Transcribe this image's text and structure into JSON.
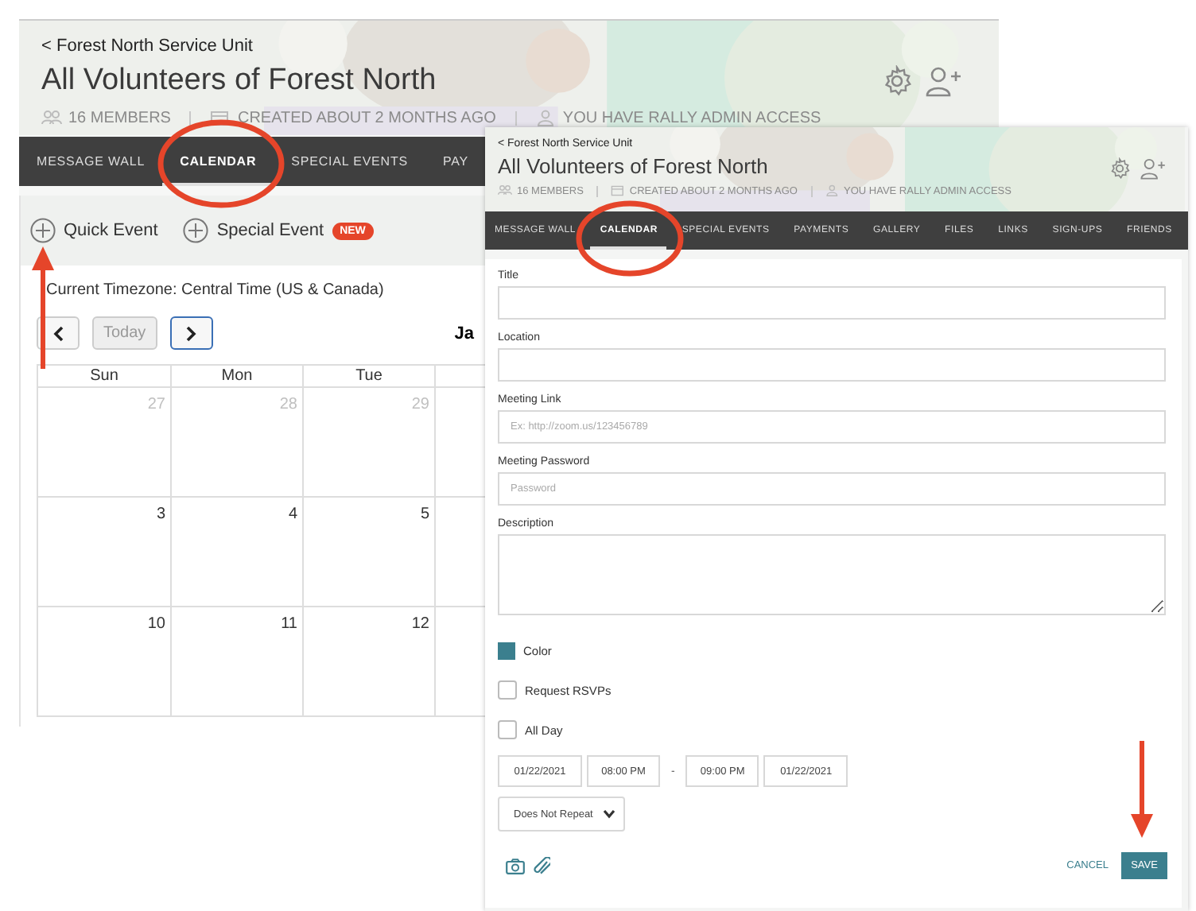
{
  "back_window": {
    "breadcrumb": "< Forest North Service Unit",
    "title": "All Volunteers of Forest North",
    "meta": [
      {
        "kind": "members",
        "text": "16 MEMBERS"
      },
      {
        "kind": "created",
        "text": "CREATED ABOUT 2 MONTHS AGO"
      },
      {
        "kind": "access",
        "text": "YOU HAVE RALLY ADMIN ACCESS"
      }
    ],
    "nav": [
      {
        "label": "MESSAGE WALL",
        "selected": false
      },
      {
        "label": "CALENDAR",
        "selected": true
      },
      {
        "label": "SPECIAL EVENTS",
        "selected": false
      },
      {
        "label": "PAY",
        "selected": false
      }
    ],
    "toolbar": [
      {
        "label": "Quick Event"
      },
      {
        "label": "Special Event",
        "badge": "NEW"
      }
    ],
    "timezone": "Current Timezone: Central Time (US & Canada)",
    "calendar": {
      "controls": [
        {
          "kind": "prev",
          "focused": false
        },
        {
          "kind": "today",
          "label": "Today",
          "disabled": true
        },
        {
          "kind": "next",
          "focused": true
        }
      ],
      "month_title": "Ja",
      "weekdays": [
        "Sun",
        "Mon",
        "Tue"
      ],
      "weeks": [
        [
          {
            "day": "27",
            "muted": true
          },
          {
            "day": "28",
            "muted": true
          },
          {
            "day": "29",
            "muted": true
          }
        ],
        [
          {
            "day": "3",
            "muted": false
          },
          {
            "day": "4",
            "muted": false
          },
          {
            "day": "5",
            "muted": false
          }
        ],
        [
          {
            "day": "10",
            "muted": false
          },
          {
            "day": "11",
            "muted": false
          },
          {
            "day": "12",
            "muted": false
          }
        ]
      ]
    }
  },
  "front_window": {
    "breadcrumb": "< Forest North Service Unit",
    "title": "All Volunteers of Forest North",
    "meta": [
      {
        "kind": "members",
        "text": "16 MEMBERS"
      },
      {
        "kind": "created",
        "text": "CREATED ABOUT 2 MONTHS AGO"
      },
      {
        "kind": "access",
        "text": "YOU HAVE RALLY ADMIN ACCESS"
      }
    ],
    "nav": [
      {
        "label": "MESSAGE WALL",
        "selected": false
      },
      {
        "label": "CALENDAR",
        "selected": true
      },
      {
        "label": "SPECIAL EVENTS",
        "selected": false
      },
      {
        "label": "PAYMENTS",
        "selected": false
      },
      {
        "label": "GALLERY",
        "selected": false
      },
      {
        "label": "FILES",
        "selected": false
      },
      {
        "label": "LINKS",
        "selected": false
      },
      {
        "label": "SIGN-UPS",
        "selected": false
      },
      {
        "label": "FRIENDS",
        "selected": false
      }
    ],
    "form": {
      "fields": [
        {
          "label": "Title",
          "kind": "text"
        },
        {
          "label": "Location",
          "kind": "text"
        },
        {
          "label": "Meeting Link",
          "kind": "text",
          "placeholder": "Ex: http://zoom.us/123456789"
        },
        {
          "label": "Meeting Password",
          "kind": "text",
          "placeholder": "Password"
        },
        {
          "label": "Description",
          "kind": "textarea"
        }
      ],
      "color": {
        "label": "Color",
        "color": "#3b7f8e"
      },
      "checkboxes": [
        {
          "label": "Request RSVPs",
          "checked": false
        },
        {
          "label": "All Day",
          "checked": false
        }
      ],
      "schedule": {
        "start_date": "01/22/2021",
        "start_time": "08:00 PM",
        "separator": "-",
        "end_time": "09:00 PM",
        "end_date": "01/22/2021"
      },
      "repeat": "Does Not Repeat",
      "cancel": "CANCEL",
      "save": "SAVE"
    }
  },
  "annotations": [
    {
      "kind": "circle"
    },
    {
      "kind": "circle"
    },
    {
      "kind": "arrow-up"
    },
    {
      "kind": "arrow-down"
    }
  ]
}
